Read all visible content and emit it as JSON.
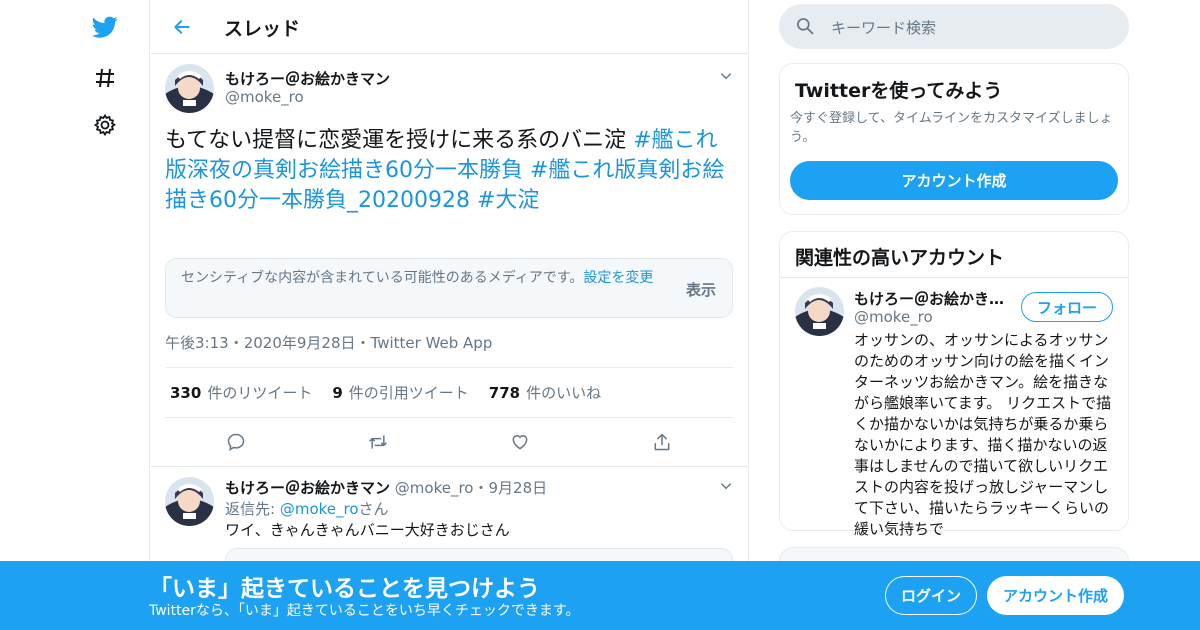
{
  "colors": {
    "accent": "#1da1f2",
    "link": "#1b95e0",
    "muted": "#657786",
    "text": "#14171a",
    "border": "#e6ecf0"
  },
  "nav": {
    "icons": [
      "twitter-bird-icon",
      "hashtag-icon",
      "gear-icon"
    ]
  },
  "header": {
    "title": "スレッド"
  },
  "tweet": {
    "name": "もけろー＠お絵かきマン",
    "handle": "@moke_ro",
    "text_plain": "もてない提督に恋愛運を授けに来る系のバニ淀 ",
    "tags": [
      "#艦これ版深夜の真剣お絵描き60分一本勝負",
      "#艦これ版真剣お絵描き60分一本勝負_20200928",
      "#大淀"
    ],
    "sensitive_text": "センシティブな内容が含まれている可能性のあるメディアです。",
    "sensitive_link": "設定を変更",
    "sensitive_show": "表示",
    "time": "午後3:13",
    "date": "2020年9月28日",
    "source": "Twitter Web App",
    "meta_sep": "・",
    "retweets_count": "330",
    "retweets_label": "件のリツイート",
    "quotes_count": "9",
    "quotes_label": "件の引用ツイート",
    "likes_count": "778",
    "likes_label": "件のいいね"
  },
  "reply": {
    "name": "もけろー＠お絵かきマン",
    "handle": "@moke_ro",
    "sep": "・",
    "date": "9月28日",
    "reply_to_label": "返信先: ",
    "reply_to_handle": "@moke_ro",
    "reply_to_suffix": "さん",
    "text": "ワイ、きゃんきゃんバニー大好きおじさん"
  },
  "search": {
    "placeholder": "キーワード検索"
  },
  "signup_card": {
    "title": "Twitterを使ってみよう",
    "desc": "今すぐ登録して、タイムラインをカスタマイズしましょう。",
    "button": "アカウント作成"
  },
  "related": {
    "title": "関連性の高いアカウント",
    "name": "もけろー＠お絵かきマン",
    "handle": "@moke_ro",
    "follow": "フォロー",
    "bio": "オッサンの、オッサンによるオッサンのためのオッサン向けの絵を描くインターネッツお絵かきマン。絵を描きながら艦娘率いてます。 リクエストで描くか描かないかは気持ちが乗るか乗らないかによります、描く描かないの返事はしませんので描いて欲しいリクエストの内容を投げっ放しジャーマンして下さい、描いたらラッキーくらいの緩い気持ちで"
  },
  "banner": {
    "title": "「いま」起きていることを見つけよう",
    "subtitle": "Twitterなら、「いま」起きていることをいち早くチェックできます。",
    "login": "ログイン",
    "signup": "アカウント作成"
  }
}
